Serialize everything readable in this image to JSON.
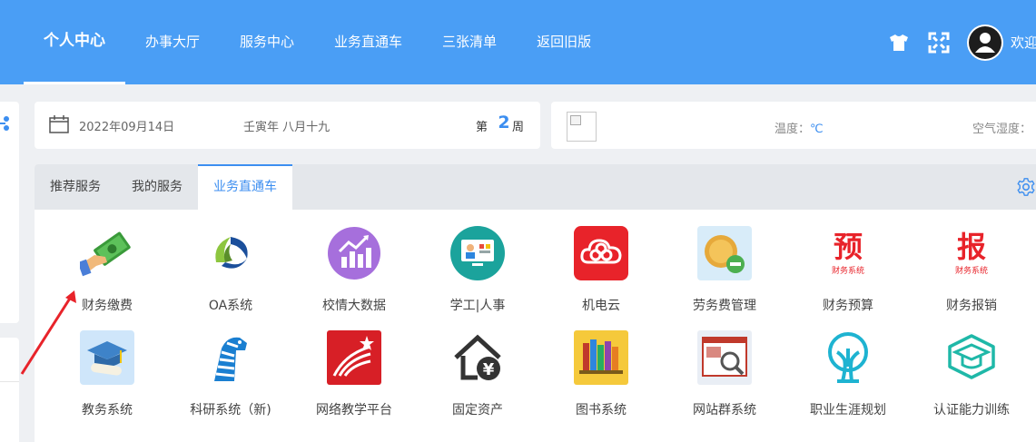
{
  "nav": {
    "items": [
      "个人中心",
      "办事大厅",
      "服务中心",
      "业务直通车",
      "三张清单",
      "返回旧版"
    ],
    "active_index": 0,
    "welcome": "欢迎"
  },
  "date_bar": {
    "date": "2022年09月14日",
    "lunar": "壬寅年 八月十九",
    "week_prefix": "第",
    "week_number": "2",
    "week_suffix": "周"
  },
  "weather": {
    "temp_label": "温度：",
    "temp_unit": "℃",
    "humidity_label": "空气湿度："
  },
  "tabs": {
    "items": [
      "推荐服务",
      "我的服务",
      "业务直通车"
    ],
    "active_index": 2
  },
  "services": [
    {
      "label": "财务缴费",
      "icon": "money-hand-icon"
    },
    {
      "label": "OA系统",
      "icon": "oa-logo-icon"
    },
    {
      "label": "校情大数据",
      "icon": "chart-icon"
    },
    {
      "label": "学工|人事",
      "icon": "monitor-people-icon"
    },
    {
      "label": "机电云",
      "icon": "cloud-icon"
    },
    {
      "label": "劳务费管理",
      "icon": "coin-icon"
    },
    {
      "label": "财务预算",
      "icon": "budget-icon",
      "glyph": "预",
      "sub": "财务系统"
    },
    {
      "label": "财务报销",
      "icon": "reimburse-icon",
      "glyph": "报",
      "sub": "财务系统"
    },
    {
      "label": "教务系统",
      "icon": "graduation-icon"
    },
    {
      "label": "科研系统（新)",
      "icon": "zebra-icon"
    },
    {
      "label": "网络教学平台",
      "icon": "teaching-platform-icon"
    },
    {
      "label": "固定资产",
      "icon": "house-yuan-icon"
    },
    {
      "label": "图书系统",
      "icon": "books-icon"
    },
    {
      "label": "网站群系统",
      "icon": "website-search-icon"
    },
    {
      "label": "职业生涯规划",
      "icon": "tree-icon"
    },
    {
      "label": "认证能力训练",
      "icon": "cap-icon"
    }
  ],
  "colors": {
    "topbar": "#4a9ef5",
    "accent": "#3c8ef0",
    "red": "#e8232a"
  }
}
